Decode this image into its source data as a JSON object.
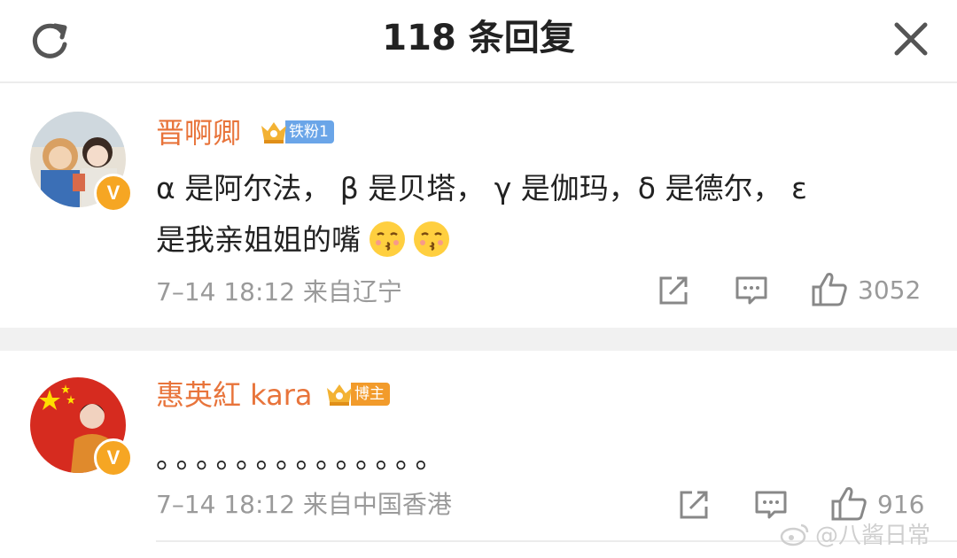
{
  "header": {
    "title": "118 条回复",
    "refresh_icon": "refresh-icon",
    "close_icon": "close-icon"
  },
  "comments": [
    {
      "username": "晋啊卿",
      "fan_badge": "铁粉1",
      "badge_color": "#6aa5e8",
      "verified": "V",
      "text_line1": "α 是阿尔法， β 是贝塔， γ 是伽玛，δ 是德尔， ε",
      "text_line2": "是我亲姐姐的嘴",
      "emojis": [
        "kiss-face-emoji",
        "kiss-face-emoji"
      ],
      "meta": "7–14 18:12  来自辽宁",
      "like_count": "3052"
    },
    {
      "username": "惠英紅 kara",
      "fan_badge": "博主",
      "badge_color": "#f29b2b",
      "verified": "V",
      "text_line1": "。。。。。。。。。。。。。。",
      "meta": "7–14 18:12  来自中国香港",
      "like_count": "916"
    }
  ],
  "watermark": "@八酱日常",
  "colors": {
    "username": "#e8743b",
    "meta": "#9a9a9a",
    "separator": "#f1f1f1"
  }
}
